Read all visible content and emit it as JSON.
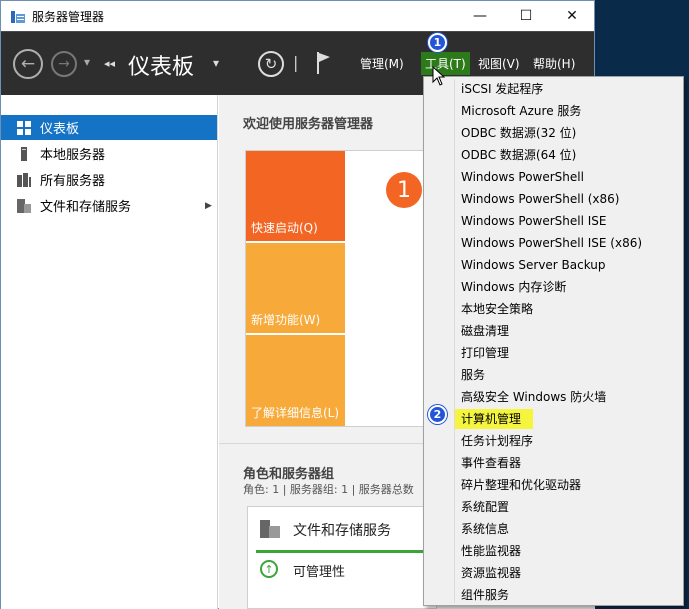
{
  "window": {
    "title": "服务器管理器",
    "minimize": "—",
    "maximize": "☐",
    "close": "✕"
  },
  "toolbar": {
    "back": "←",
    "forward": "→",
    "history_chevron": "▾",
    "breadcrumb_chevrons": "◂◂",
    "breadcrumb": "仪表板",
    "breadcrumb_dropdown": "▾",
    "refresh": "↻",
    "separator": "|",
    "menus": {
      "manage": "管理(M)",
      "tools": "工具(T)",
      "view": "视图(V)",
      "help": "帮助(H)"
    }
  },
  "sidebar": {
    "items": [
      {
        "label": "仪表板"
      },
      {
        "label": "本地服务器"
      },
      {
        "label": "所有服务器"
      },
      {
        "label": "文件和存储服务"
      }
    ],
    "expand_arrow": "▶"
  },
  "dashboard": {
    "welcome": "欢迎使用服务器管理器",
    "tiles": {
      "quick_start": "快速启动(Q)",
      "whats_new": "新增功能(W)",
      "learn_more": "了解详细信息(L)"
    },
    "step_number": "1",
    "roles_heading": "角色和服务器组",
    "roles_summary": "角色: 1 | 服务器组: 1 | 服务器总数",
    "role_card": {
      "title": "文件和存储服务",
      "status": "可管理性"
    }
  },
  "tools_menu": {
    "items": [
      "iSCSI 发起程序",
      "Microsoft Azure 服务",
      "ODBC 数据源(32 位)",
      "ODBC 数据源(64 位)",
      "Windows PowerShell",
      "Windows PowerShell (x86)",
      "Windows PowerShell ISE",
      "Windows PowerShell ISE (x86)",
      "Windows Server Backup",
      "Windows 内存诊断",
      "本地安全策略",
      "磁盘清理",
      "打印管理",
      "服务",
      "高级安全 Windows 防火墙",
      "计算机管理",
      "任务计划程序",
      "事件查看器",
      "碎片整理和优化驱动器",
      "系统配置",
      "系统信息",
      "性能监视器",
      "资源监视器",
      "组件服务"
    ]
  },
  "callouts": {
    "one": "1",
    "two": "2"
  },
  "colors": {
    "accent": "#1473c5",
    "quick_start": "#f26522",
    "tile": "#f7aa3a",
    "highlight": "#f5f540",
    "callout": "#2255d8",
    "toolbar": "#2e2e2e"
  }
}
